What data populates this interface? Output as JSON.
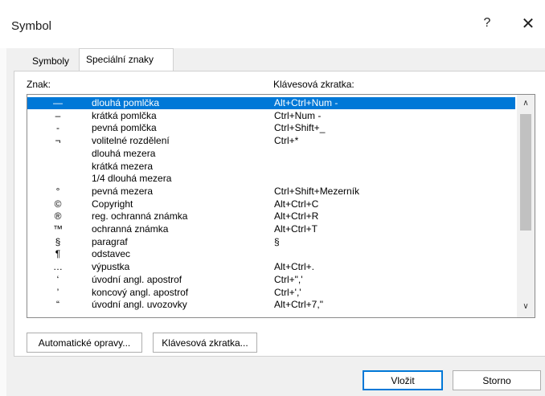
{
  "window": {
    "title": "Symbol",
    "help": "?",
    "close": "✕"
  },
  "tabs": [
    {
      "label": "Symboly",
      "active": false
    },
    {
      "label": "Speciální znaky",
      "active": true
    }
  ],
  "headers": {
    "char": "Znak:",
    "shortcut": "Klávesová zkratka:"
  },
  "rows": [
    {
      "char": "—",
      "name": "dlouhá pomlčka",
      "shortcut": "Alt+Ctrl+Num -",
      "selected": true
    },
    {
      "char": "–",
      "name": "krátká pomlčka",
      "shortcut": "Ctrl+Num -"
    },
    {
      "char": "-",
      "name": "pevná pomlčka",
      "shortcut": "Ctrl+Shift+_"
    },
    {
      "char": "¬",
      "name": "volitelné rozdělení",
      "shortcut": "Ctrl+*"
    },
    {
      "char": "",
      "name": "dlouhá mezera",
      "shortcut": ""
    },
    {
      "char": "",
      "name": "krátká mezera",
      "shortcut": ""
    },
    {
      "char": "",
      "name": "1/4 dlouhá mezera",
      "shortcut": ""
    },
    {
      "char": "°",
      "name": "pevná mezera",
      "shortcut": "Ctrl+Shift+Mezerník"
    },
    {
      "char": "©",
      "name": "Copyright",
      "shortcut": "Alt+Ctrl+C"
    },
    {
      "char": "®",
      "name": "reg. ochranná známka",
      "shortcut": "Alt+Ctrl+R"
    },
    {
      "char": "™",
      "name": "ochranná známka",
      "shortcut": "Alt+Ctrl+T"
    },
    {
      "char": "§",
      "name": "paragraf",
      "shortcut": "§"
    },
    {
      "char": "¶",
      "name": "odstavec",
      "shortcut": ""
    },
    {
      "char": "…",
      "name": "výpustka",
      "shortcut": "Alt+Ctrl+."
    },
    {
      "char": "‘",
      "name": "úvodní angl. apostrof",
      "shortcut": "Ctrl+\",'"
    },
    {
      "char": "’",
      "name": "koncový angl. apostrof",
      "shortcut": "Ctrl+','"
    },
    {
      "char": "“",
      "name": "úvodní angl. uvozovky",
      "shortcut": "Alt+Ctrl+7,\""
    }
  ],
  "buttons": {
    "autocorrect": "Automatické opravy...",
    "shortcut_key": "Klávesová zkratka...",
    "insert": "Vložit",
    "cancel": "Storno"
  },
  "scroll": {
    "up": "∧",
    "down": "∨"
  }
}
